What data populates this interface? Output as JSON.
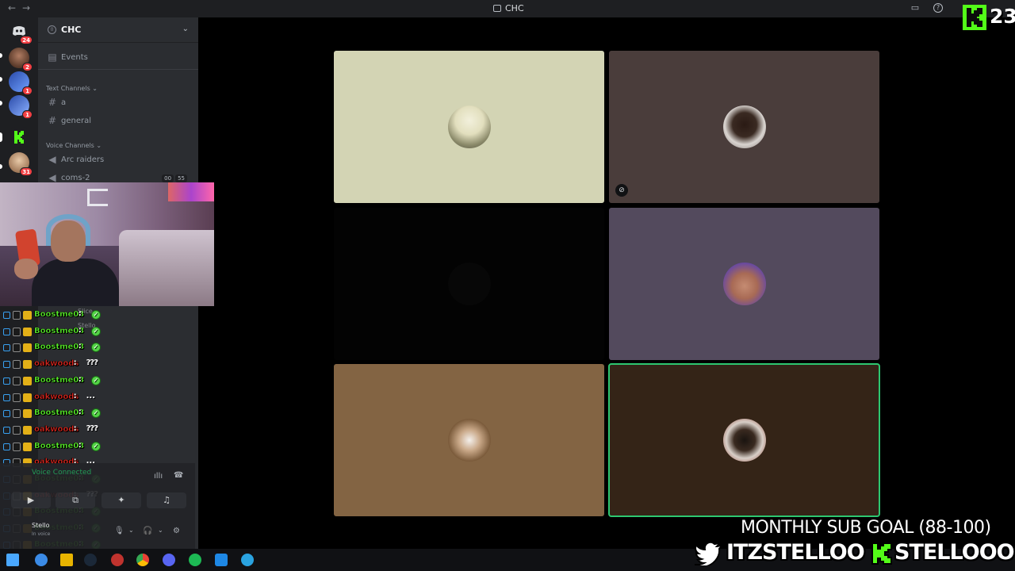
{
  "window": {
    "title": "CHC"
  },
  "server": {
    "name": "CHC",
    "events_label": "Events",
    "text_category": "Text Channels",
    "text_channels": [
      "a",
      "general"
    ],
    "voice_category": "Voice Channels",
    "voice_channels": [
      "Arc raiders",
      "coms-2"
    ],
    "voice_counts": [
      "00",
      "55"
    ]
  },
  "rail_badges": [
    "24",
    "2",
    "1",
    "1",
    "31"
  ],
  "chat": {
    "messages": [
      {
        "user": "Boostme03",
        "sep": " :",
        "kind": "emote",
        "color": "#59f02a"
      },
      {
        "user": "Boostme03",
        "sep": " :",
        "kind": "emote",
        "color": "#59f02a"
      },
      {
        "user": "Boostme03",
        "sep": " :",
        "kind": "emote",
        "color": "#59f02a"
      },
      {
        "user": "oakwoods",
        "sep": " :",
        "kind": "qqq",
        "text": "???",
        "color": "#d7261e"
      },
      {
        "user": "Boostme03",
        "sep": " :",
        "kind": "emote",
        "color": "#59f02a"
      },
      {
        "user": "oakwoods",
        "sep": " :",
        "kind": "dots",
        "text": "...",
        "color": "#d7261e"
      },
      {
        "user": "Boostme03",
        "sep": " :",
        "kind": "emote",
        "color": "#59f02a"
      },
      {
        "user": "oakwoods",
        "sep": " :",
        "kind": "qqq",
        "text": "???",
        "color": "#d7261e"
      },
      {
        "user": "Boostme03",
        "sep": " :",
        "kind": "emote",
        "color": "#59f02a"
      },
      {
        "user": "oakwoods",
        "sep": " :",
        "kind": "dots",
        "text": "...",
        "color": "#d7261e"
      },
      {
        "user": "Boostme03",
        "sep": " :",
        "kind": "emote",
        "color": "#59f02a"
      },
      {
        "user": "oakwoods",
        "sep": " :",
        "kind": "qqq",
        "text": "???",
        "color": "#d7261e"
      },
      {
        "user": "Boostme03",
        "sep": " :",
        "kind": "emote",
        "color": "#59f02a"
      },
      {
        "user": "Boostme03",
        "sep": " :",
        "kind": "emote",
        "color": "#59f02a"
      },
      {
        "user": "Boostme03",
        "sep": " :",
        "kind": "emote",
        "color": "#59f02a"
      },
      {
        "user": "oakwoods",
        "sep": " :",
        "kind": "none",
        "text": "",
        "color": "#d7261e"
      }
    ],
    "faded_names": [
      "Slice",
      "Stello"
    ]
  },
  "voice_panel": {
    "status": "Voice Connected",
    "user": "Stello",
    "sub": "In voice"
  },
  "call": {
    "tiles": [
      {
        "bg": "#d3d4b4",
        "avatar": "hooded-figure",
        "muted": false,
        "speaking": false
      },
      {
        "bg": "#4a3d3b",
        "avatar": "man-face",
        "muted": true,
        "speaking": false
      },
      {
        "bg": "#030303",
        "avatar": "none",
        "muted": false,
        "speaking": false
      },
      {
        "bg": "#534a5d",
        "avatar": "man-headset",
        "muted": false,
        "speaking": false
      },
      {
        "bg": "#836443",
        "avatar": "basketball-player",
        "muted": false,
        "speaking": false
      },
      {
        "bg": "#342417",
        "avatar": "court-player",
        "muted": false,
        "speaking": true
      }
    ]
  },
  "overlay": {
    "kick_count": "23",
    "sub_goal": "MONTHLY SUB GOAL (88-100)",
    "twitter_handle": "ITZSTELLOO",
    "kick_handle": "STELLOOO",
    "brand_green": "#53fc18"
  }
}
